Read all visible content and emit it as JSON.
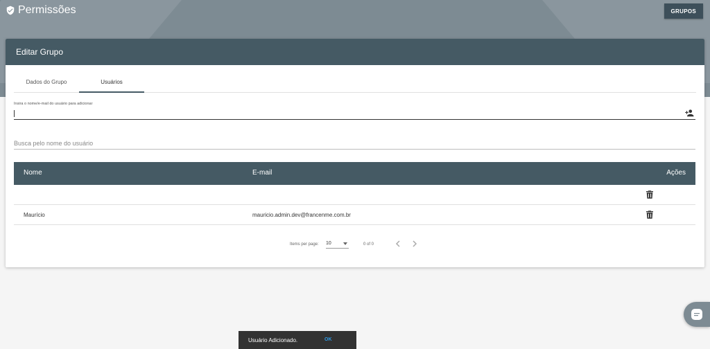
{
  "app": {
    "title": "Permissões"
  },
  "top_nav": {
    "groups_button": "GRUPOS"
  },
  "card": {
    "title": "Editar Grupo"
  },
  "tabs": [
    {
      "label": "Dados do Grupo",
      "active": false
    },
    {
      "label": "Usuários",
      "active": true
    }
  ],
  "add_user": {
    "label": "Insira o nome/e-mail do usuário para adicionar",
    "value": ""
  },
  "search": {
    "placeholder": "Busca pelo nome do usuário"
  },
  "table": {
    "columns": [
      "Nome",
      "E-mail",
      "Ações"
    ],
    "rows": [
      {
        "nome": "",
        "email": ""
      },
      {
        "nome": "Maurício",
        "email": "mauricio.admin.dev@francenme.com.br"
      }
    ]
  },
  "paginator": {
    "items_per_page_label": "Items per page:",
    "page_size": "10",
    "range": "0 of 0"
  },
  "snackbar": {
    "message": "Usuário Adicionado.",
    "action": "OK"
  },
  "colors": {
    "primary": "#455a64",
    "hero": "#7d8b93",
    "snackbar": "#323232",
    "snackbar_action": "#2f9be6"
  }
}
